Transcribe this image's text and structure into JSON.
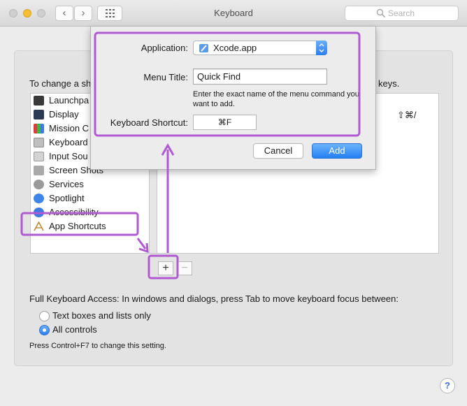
{
  "window": {
    "title": "Keyboard",
    "back_glyph": "‹",
    "forward_glyph": "›",
    "search_placeholder": "Search"
  },
  "pane": {
    "instruction_left": "To change a sh",
    "instruction_right": "keys.",
    "categories": [
      {
        "label": "Launchpa",
        "icon": "launchpad-icon"
      },
      {
        "label": "Display",
        "icon": "display-icon"
      },
      {
        "label": "Mission C",
        "icon": "mission-control-icon"
      },
      {
        "label": "Keyboard",
        "icon": "keyboard-icon"
      },
      {
        "label": "Input Sou",
        "icon": "input-sources-icon"
      },
      {
        "label": "Screen Shots",
        "icon": "screenshot-icon"
      },
      {
        "label": "Services",
        "icon": "gear-icon"
      },
      {
        "label": "Spotlight",
        "icon": "spotlight-icon"
      },
      {
        "label": "Accessibility",
        "icon": "accessibility-icon"
      },
      {
        "label": "App Shortcuts",
        "icon": "app-shortcuts-icon"
      }
    ],
    "detail_shortcut": "⇧⌘/",
    "add_glyph": "+",
    "remove_glyph": "−",
    "full_keyboard_access": "Full Keyboard Access: In windows and dialogs, press Tab to move keyboard focus between:",
    "radio_options": [
      {
        "label": "Text boxes and lists only",
        "selected": false
      },
      {
        "label": "All controls",
        "selected": true
      }
    ],
    "hint": "Press Control+F7 to change this setting.",
    "help_glyph": "?"
  },
  "sheet": {
    "application_label": "Application:",
    "application_value": "Xcode.app",
    "menu_title_label": "Menu Title:",
    "menu_title_value": "Quick Find",
    "help_note": "Enter the exact name of the menu command you want to add.",
    "shortcut_label": "Keyboard Shortcut:",
    "shortcut_value": "⌘F",
    "cancel_label": "Cancel",
    "add_label": "Add"
  },
  "colors": {
    "accent": "#2d7ff3",
    "annotation": "#b05ad2"
  }
}
